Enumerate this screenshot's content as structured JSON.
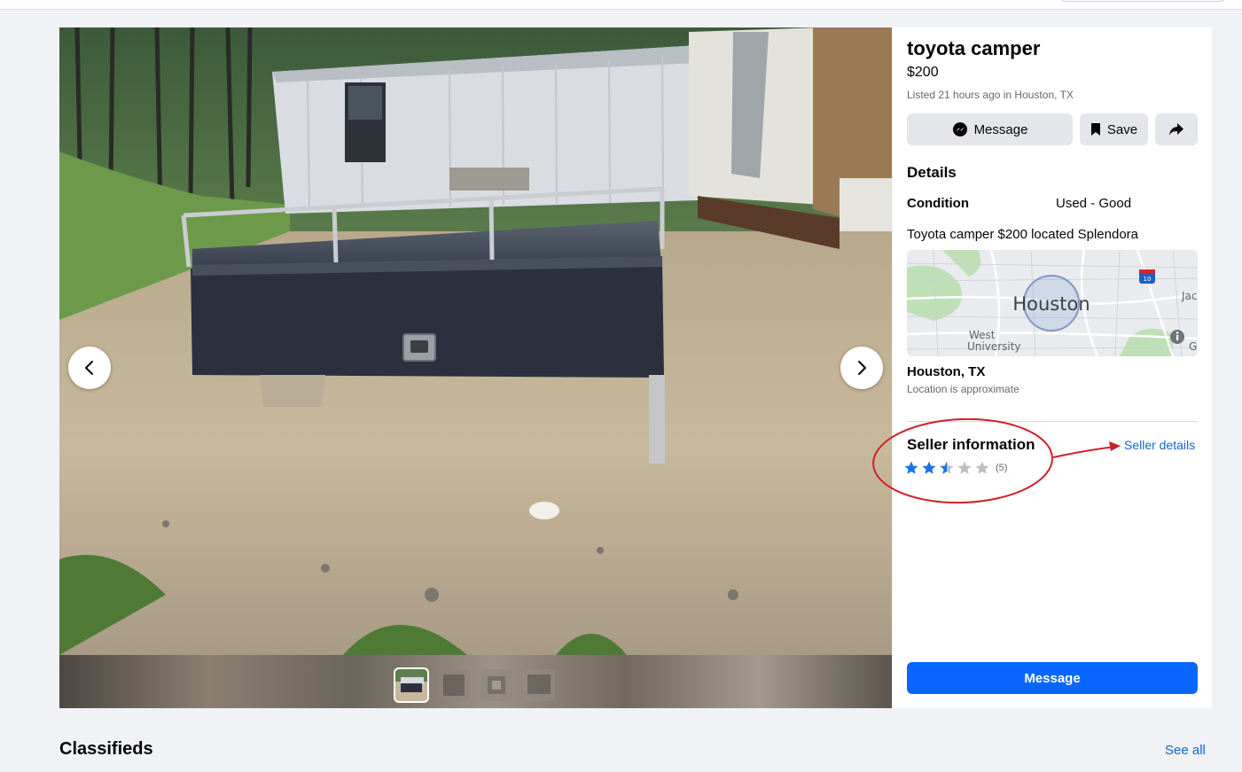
{
  "listing": {
    "title": "toyota camper",
    "price": "$200",
    "listed": "Listed 21 hours ago in Houston, TX"
  },
  "actions": {
    "message_label": "Message",
    "save_label": "Save",
    "share_icon": "share-arrow-icon"
  },
  "details": {
    "heading": "Details",
    "condition_label": "Condition",
    "condition_value": "Used - Good",
    "description": "Toyota camper $200 located Splendora"
  },
  "map": {
    "city_label": "Houston",
    "area_label_1": "West",
    "area_label_2": "University",
    "edge_label_1": "Jac",
    "edge_label_2": "G",
    "highway_shield": "10"
  },
  "location": {
    "name": "Houston, TX",
    "note": "Location is approximate"
  },
  "seller": {
    "heading": "Seller information",
    "details_link": "Seller details",
    "rating": 2.5,
    "rating_max": 5,
    "rating_count": "(5)"
  },
  "primary_action": {
    "label": "Message"
  },
  "classifieds": {
    "heading": "Classifieds",
    "see_all": "See all"
  },
  "gallery": {
    "image_count": 4,
    "active_index": 0
  },
  "colors": {
    "accent": "#0866ff",
    "link": "#1763cf",
    "annotation": "#d0202a",
    "star_filled": "#1b74e4",
    "star_empty": "#bcc0c4"
  }
}
